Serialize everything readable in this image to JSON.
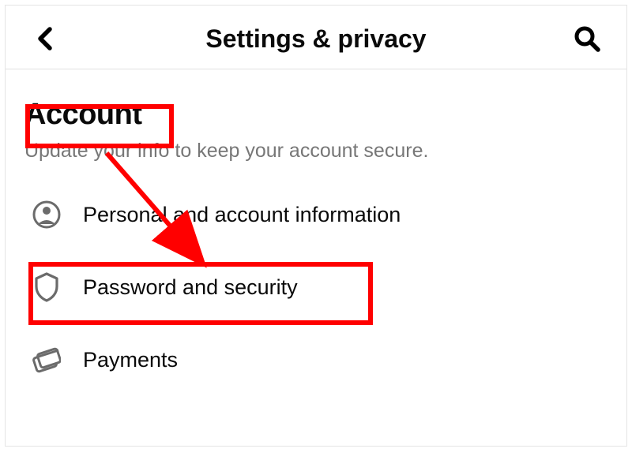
{
  "header": {
    "title": "Settings & privacy"
  },
  "section": {
    "title": "Account",
    "subtitle": "Update your info to keep your account secure."
  },
  "items": [
    {
      "label": "Personal and account information"
    },
    {
      "label": "Password and security"
    },
    {
      "label": "Payments"
    }
  ]
}
